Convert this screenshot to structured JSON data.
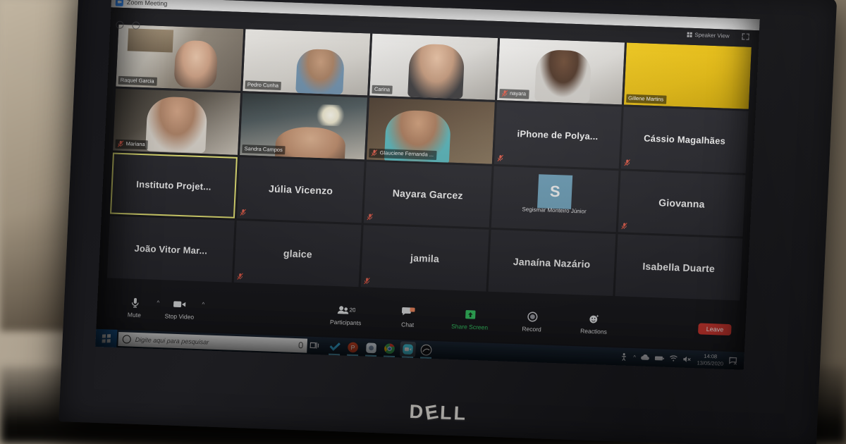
{
  "photo": {
    "device_brand": "DELL",
    "scene_description": "Photo of a Dell laptop screen showing a Zoom meeting"
  },
  "window": {
    "title": "Zoom Meeting",
    "app_icon": "zoom-camera-icon",
    "view_mode": "Speaker View",
    "fullscreen_icon": "fullscreen-icon",
    "grid_icon": "grid-icon"
  },
  "participants": [
    {
      "name": "Raquel Garcia",
      "layout": "video",
      "label_style": "bar",
      "muted": false,
      "video_class": "v-raquel",
      "active": false
    },
    {
      "name": "Pedro Cunha",
      "layout": "video",
      "label_style": "bar",
      "muted": false,
      "video_class": "v-pedro",
      "active": false
    },
    {
      "name": "Carina",
      "layout": "video",
      "label_style": "bar",
      "muted": false,
      "video_class": "v-carina",
      "active": false
    },
    {
      "name": "nayara",
      "layout": "video",
      "label_style": "bar",
      "muted": true,
      "video_class": "v-nayara",
      "active": false
    },
    {
      "name": "Gillene Martins",
      "layout": "video",
      "label_style": "bar",
      "muted": false,
      "video_class": "v-gillene",
      "active": false
    },
    {
      "name": "Mariana",
      "layout": "video",
      "label_style": "bar",
      "muted": true,
      "video_class": "v-mariana",
      "active": false
    },
    {
      "name": "Sandra Campos",
      "layout": "video",
      "label_style": "bar",
      "muted": false,
      "video_class": "v-sandra",
      "active": false
    },
    {
      "name": "Glauciene Fernanda ...",
      "layout": "video",
      "label_style": "bar",
      "muted": true,
      "video_class": "v-glauciene",
      "active": false
    },
    {
      "name": "iPhone de Polya...",
      "layout": "name",
      "label_style": "big",
      "muted": true,
      "video_class": "",
      "active": false
    },
    {
      "name": "Cássio Magalhães",
      "layout": "name",
      "label_style": "big",
      "muted": true,
      "video_class": "",
      "active": false
    },
    {
      "name": "Instituto  Projet...",
      "layout": "name",
      "label_style": "big",
      "muted": false,
      "video_class": "",
      "active": true
    },
    {
      "name": "Júlia Vicenzo",
      "layout": "name",
      "label_style": "big",
      "muted": true,
      "video_class": "",
      "active": false
    },
    {
      "name": "Nayara Garcez",
      "layout": "name",
      "label_style": "big",
      "muted": true,
      "video_class": "",
      "active": false
    },
    {
      "name": "Segismar Monteiro Júnior",
      "layout": "avatar",
      "label_style": "small",
      "muted": false,
      "avatar_letter": "S",
      "avatar_color": "#74a9c4",
      "active": false
    },
    {
      "name": "Giovanna",
      "layout": "name",
      "label_style": "big",
      "muted": true,
      "video_class": "",
      "active": false
    },
    {
      "name": "João  Vitor Mar...",
      "layout": "name",
      "label_style": "big",
      "muted": false,
      "video_class": "",
      "active": false
    },
    {
      "name": "glaice",
      "layout": "name",
      "label_style": "big",
      "muted": true,
      "video_class": "",
      "active": false
    },
    {
      "name": "jamila",
      "layout": "name",
      "label_style": "big",
      "muted": true,
      "video_class": "",
      "active": false
    },
    {
      "name": "Janaína Nazário",
      "layout": "name",
      "label_style": "big",
      "muted": false,
      "video_class": "",
      "active": false
    },
    {
      "name": "Isabella Duarte",
      "layout": "name",
      "label_style": "big",
      "muted": false,
      "video_class": "",
      "active": false
    }
  ],
  "toolbar": {
    "mute_label": "Mute",
    "mute_icon": "microphone-icon",
    "video_label": "Stop Video",
    "video_icon": "video-camera-icon",
    "participants_label": "Participants",
    "participants_icon": "people-icon",
    "participants_count": "20",
    "chat_label": "Chat",
    "chat_icon": "chat-bubble-icon",
    "chat_badge": "",
    "share_label": "Share Screen",
    "share_icon": "share-screen-up-arrow-icon",
    "share_color": "#3ad06a",
    "record_label": "Record",
    "record_icon": "record-circle-icon",
    "reactions_label": "Reactions",
    "reactions_icon": "smiley-reactions-icon",
    "leave_label": "Leave",
    "leave_color": "#d33a33",
    "caret_icon": "chevron-up-icon"
  },
  "taskbar": {
    "start_icon": "windows-start-icon",
    "search_placeholder": "Digite aqui para pesquisar",
    "cortana_icon": "cortana-circle-icon",
    "search_mic_icon": "microphone-icon",
    "task_view_icon": "task-view-icon",
    "apps": [
      {
        "name": "todoist-checkmark-icon",
        "color": "#3ab6e8",
        "active": false
      },
      {
        "name": "powerpoint-icon",
        "color": "#d24726",
        "active": false
      },
      {
        "name": "photos-app-icon",
        "color": "#e9f2fb",
        "active": false
      },
      {
        "name": "google-chrome-icon",
        "color": "#f0b400",
        "active": false
      },
      {
        "name": "zoom-app-icon",
        "color": "#4ad9f0",
        "active": true
      },
      {
        "name": "dark-circle-app-icon",
        "color": "#d9d9d9",
        "active": false
      }
    ],
    "tray": {
      "accessibility_icon": "person-accessibility-icon",
      "chevron_icon": "chevron-up-icon",
      "cloud_icon": "onedrive-cloud-icon",
      "battery_icon": "battery-icon",
      "wifi_icon": "wifi-icon",
      "volume_icon": "volume-muted-icon",
      "time": "14:08",
      "date": "13/05/2020",
      "notifications_icon": "notification-flag-icon"
    }
  }
}
